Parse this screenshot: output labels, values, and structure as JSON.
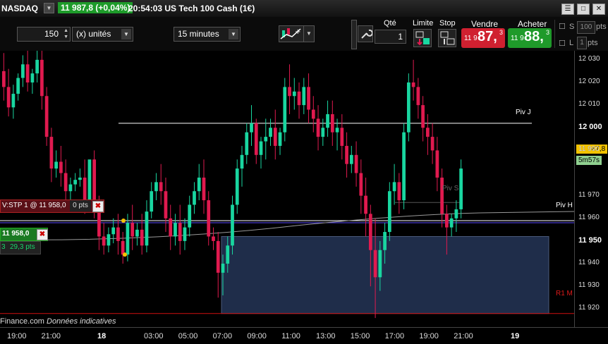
{
  "titlebar": {
    "symbol": "NASDAQ",
    "price_badge": "11 987,8 (+0,04%)",
    "info": "20:54:03 US Tech 100 Cash (1€)"
  },
  "toolbar": {
    "quantity_value": "150",
    "unit_select": "(x) unités",
    "timeframe_select": "15 minutes",
    "qty_label": "Qté",
    "qty_value": "1",
    "limit_label": "Limite",
    "stop_label": "Stop",
    "sell_label": "Vendre",
    "buy_label": "Acheter",
    "sell_small": "11 9",
    "sell_big": "87,",
    "sell_sup": "3",
    "buy_small": "11 9",
    "buy_big": "88,",
    "buy_sup": "3",
    "s_label": "S",
    "s_value": "100",
    "s_unit": "pts",
    "l_label": "L",
    "l_value": "1",
    "l_unit": "pts"
  },
  "chart": {
    "piv_j_label": "Piv J",
    "piv_h_label": "Piv H",
    "r1_label": "R1 M",
    "piv_s_label": "Piv S",
    "current_price_tag": "11 987,8",
    "countdown_tag": "5m57s",
    "order_stop_label": "V:STP  1 @ 11 958,0",
    "order_stop_pts": "0 pts",
    "position_label": "11 958,0",
    "position_qty": "3",
    "position_pts": "29,3 pts",
    "footer_text": "Finance.com",
    "footer_italic": "Données indicatives",
    "colors": {
      "up": "#19d6a0",
      "down": "#e01a4f",
      "pivot": "#ffffff",
      "zone": "#1f2d4a"
    }
  },
  "chart_data": {
    "type": "candlestick",
    "ylim": [
      11912,
      12034
    ],
    "y_ticks": [
      "12 030",
      "12 020",
      "12 010",
      "12 000",
      "11 990",
      "11 970",
      "11 960",
      "11 950",
      "11 940",
      "11 930",
      "11 920"
    ],
    "y_major": [
      "12 000",
      "11 950"
    ],
    "x_ticks": [
      "19:00",
      "21:00",
      "18",
      "03:00",
      "05:00",
      "07:00",
      "09:00",
      "11:00",
      "13:00",
      "15:00",
      "17:00",
      "19:00",
      "21:00",
      "19"
    ],
    "x_major": [
      "18",
      "19"
    ],
    "pivot_lines": [
      {
        "name": "Piv J",
        "value": 12002
      },
      {
        "name": "Piv H",
        "value": 11959
      },
      {
        "name": "R1 M",
        "value": 11918
      }
    ],
    "candles": [
      {
        "o": 12025,
        "h": 12033,
        "c": 12018,
        "l": 12012
      },
      {
        "o": 12018,
        "h": 12026,
        "c": 12009,
        "l": 12005
      },
      {
        "o": 12009,
        "h": 12019,
        "c": 12015,
        "l": 12004
      },
      {
        "o": 12015,
        "h": 12024,
        "c": 12022,
        "l": 12012
      },
      {
        "o": 12022,
        "h": 12032,
        "c": 12028,
        "l": 12018
      },
      {
        "o": 12028,
        "h": 12034,
        "c": 12020,
        "l": 12016
      },
      {
        "o": 12020,
        "h": 12026,
        "c": 12024,
        "l": 12015
      },
      {
        "o": 12024,
        "h": 12034,
        "c": 12030,
        "l": 12020
      },
      {
        "o": 12030,
        "h": 12034,
        "c": 12014,
        "l": 12008
      },
      {
        "o": 12014,
        "h": 12018,
        "c": 11996,
        "l": 11992
      },
      {
        "o": 11996,
        "h": 12000,
        "c": 11982,
        "l": 11976
      },
      {
        "o": 11982,
        "h": 11990,
        "c": 11985,
        "l": 11978
      },
      {
        "o": 11985,
        "h": 11992,
        "c": 11980,
        "l": 11974
      },
      {
        "o": 11980,
        "h": 11986,
        "c": 11972,
        "l": 11968
      },
      {
        "o": 11972,
        "h": 11978,
        "c": 11975,
        "l": 11966
      },
      {
        "o": 11975,
        "h": 11980,
        "c": 11977,
        "l": 11972
      },
      {
        "o": 11977,
        "h": 11982,
        "c": 11978,
        "l": 11974
      },
      {
        "o": 11978,
        "h": 11986,
        "c": 11968,
        "l": 11962
      },
      {
        "o": 11968,
        "h": 11976,
        "c": 11986,
        "l": 11965
      },
      {
        "o": 11986,
        "h": 11990,
        "c": 11966,
        "l": 11960
      },
      {
        "o": 11966,
        "h": 11970,
        "c": 11952,
        "l": 11946
      },
      {
        "o": 11952,
        "h": 11958,
        "c": 11948,
        "l": 11944
      },
      {
        "o": 11948,
        "h": 11956,
        "c": 11953,
        "l": 11945
      },
      {
        "o": 11953,
        "h": 11960,
        "c": 11956,
        "l": 11949
      },
      {
        "o": 11956,
        "h": 11962,
        "c": 11950,
        "l": 11944
      },
      {
        "o": 11950,
        "h": 11954,
        "c": 11944,
        "l": 11940
      },
      {
        "o": 11944,
        "h": 11962,
        "c": 11958,
        "l": 11941
      },
      {
        "o": 11958,
        "h": 11966,
        "c": 11952,
        "l": 11946
      },
      {
        "o": 11952,
        "h": 11958,
        "c": 11955,
        "l": 11948
      },
      {
        "o": 11955,
        "h": 11962,
        "c": 11948,
        "l": 11944
      },
      {
        "o": 11948,
        "h": 11968,
        "c": 11963,
        "l": 11945
      },
      {
        "o": 11963,
        "h": 11976,
        "c": 11972,
        "l": 11960
      },
      {
        "o": 11972,
        "h": 11980,
        "c": 11976,
        "l": 11968
      },
      {
        "o": 11976,
        "h": 11984,
        "c": 11972,
        "l": 11966
      },
      {
        "o": 11972,
        "h": 11978,
        "c": 11960,
        "l": 11954
      },
      {
        "o": 11960,
        "h": 11966,
        "c": 11952,
        "l": 11946
      },
      {
        "o": 11952,
        "h": 11962,
        "c": 11958,
        "l": 11948
      },
      {
        "o": 11958,
        "h": 11966,
        "c": 11950,
        "l": 11944
      },
      {
        "o": 11950,
        "h": 11960,
        "c": 11956,
        "l": 11946
      },
      {
        "o": 11956,
        "h": 11970,
        "c": 11966,
        "l": 11952
      },
      {
        "o": 11966,
        "h": 11976,
        "c": 11972,
        "l": 11962
      },
      {
        "o": 11972,
        "h": 11984,
        "c": 11978,
        "l": 11968
      },
      {
        "o": 11978,
        "h": 11986,
        "c": 11968,
        "l": 11962
      },
      {
        "o": 11968,
        "h": 11972,
        "c": 11952,
        "l": 11948
      },
      {
        "o": 11952,
        "h": 11956,
        "c": 11950,
        "l": 11946
      },
      {
        "o": 11950,
        "h": 11954,
        "c": 11936,
        "l": 11925
      },
      {
        "o": 11936,
        "h": 11944,
        "c": 11940,
        "l": 11926
      },
      {
        "o": 11940,
        "h": 11952,
        "c": 11948,
        "l": 11936
      },
      {
        "o": 11948,
        "h": 11970,
        "c": 11966,
        "l": 11944
      },
      {
        "o": 11966,
        "h": 11986,
        "c": 11982,
        "l": 11962
      },
      {
        "o": 11982,
        "h": 11992,
        "c": 11988,
        "l": 11974
      },
      {
        "o": 11988,
        "h": 12002,
        "c": 11998,
        "l": 11984
      },
      {
        "o": 11998,
        "h": 12010,
        "c": 12002,
        "l": 11992
      },
      {
        "o": 12002,
        "h": 12004,
        "c": 11988,
        "l": 11984
      },
      {
        "o": 11988,
        "h": 11996,
        "c": 11994,
        "l": 11982
      },
      {
        "o": 11994,
        "h": 12004,
        "c": 11996,
        "l": 11986
      },
      {
        "o": 11996,
        "h": 12004,
        "c": 12000,
        "l": 11992
      },
      {
        "o": 12000,
        "h": 12008,
        "c": 11992,
        "l": 11986
      },
      {
        "o": 11992,
        "h": 12000,
        "c": 11998,
        "l": 11988
      },
      {
        "o": 11998,
        "h": 12022,
        "c": 12018,
        "l": 11994
      },
      {
        "o": 12018,
        "h": 12028,
        "c": 12014,
        "l": 12006
      },
      {
        "o": 12014,
        "h": 12022,
        "c": 12016,
        "l": 12008
      },
      {
        "o": 12016,
        "h": 12020,
        "c": 12010,
        "l": 12004
      },
      {
        "o": 12010,
        "h": 12022,
        "c": 12018,
        "l": 12006
      },
      {
        "o": 12018,
        "h": 12024,
        "c": 12008,
        "l": 12002
      },
      {
        "o": 12008,
        "h": 12014,
        "c": 12004,
        "l": 11998
      },
      {
        "o": 12004,
        "h": 12010,
        "c": 11996,
        "l": 11990
      },
      {
        "o": 11996,
        "h": 12004,
        "c": 12000,
        "l": 11992
      },
      {
        "o": 12000,
        "h": 12012,
        "c": 12006,
        "l": 11996
      },
      {
        "o": 12006,
        "h": 12012,
        "c": 11998,
        "l": 11992
      },
      {
        "o": 11998,
        "h": 12004,
        "c": 12000,
        "l": 11990
      },
      {
        "o": 12000,
        "h": 12006,
        "c": 11992,
        "l": 11986
      },
      {
        "o": 11992,
        "h": 11998,
        "c": 11984,
        "l": 11978
      },
      {
        "o": 11984,
        "h": 11992,
        "c": 11988,
        "l": 11980
      },
      {
        "o": 11988,
        "h": 11994,
        "c": 11980,
        "l": 11974
      },
      {
        "o": 11980,
        "h": 11986,
        "c": 11970,
        "l": 11962
      },
      {
        "o": 11970,
        "h": 11978,
        "c": 11962,
        "l": 11952
      },
      {
        "o": 11962,
        "h": 11966,
        "c": 11946,
        "l": 11930
      },
      {
        "o": 11946,
        "h": 11960,
        "c": 11934,
        "l": 11916
      },
      {
        "o": 11934,
        "h": 11950,
        "c": 11946,
        "l": 11928
      },
      {
        "o": 11946,
        "h": 11958,
        "c": 11954,
        "l": 11940
      },
      {
        "o": 11954,
        "h": 11976,
        "c": 11972,
        "l": 11950
      },
      {
        "o": 11972,
        "h": 11984,
        "c": 11976,
        "l": 11966
      },
      {
        "o": 11976,
        "h": 11980,
        "c": 11968,
        "l": 11962
      },
      {
        "o": 11968,
        "h": 12002,
        "c": 11998,
        "l": 11964
      },
      {
        "o": 11998,
        "h": 12024,
        "c": 12020,
        "l": 11994
      },
      {
        "o": 12020,
        "h": 12030,
        "c": 12018,
        "l": 12012
      },
      {
        "o": 12018,
        "h": 12022,
        "c": 12010,
        "l": 12004
      },
      {
        "o": 12010,
        "h": 12014,
        "c": 12000,
        "l": 11994
      },
      {
        "o": 12000,
        "h": 12006,
        "c": 11996,
        "l": 11988
      },
      {
        "o": 11996,
        "h": 12002,
        "c": 11990,
        "l": 11984
      },
      {
        "o": 11990,
        "h": 11996,
        "c": 11978,
        "l": 11972
      },
      {
        "o": 11978,
        "h": 11982,
        "c": 11962,
        "l": 11956
      },
      {
        "o": 11962,
        "h": 11966,
        "c": 11956,
        "l": 11944
      },
      {
        "o": 11956,
        "h": 11962,
        "c": 11960,
        "l": 11952
      },
      {
        "o": 11960,
        "h": 11968,
        "c": 11964,
        "l": 11954
      },
      {
        "o": 11964,
        "h": 11986,
        "c": 11982,
        "l": 11960
      }
    ]
  }
}
